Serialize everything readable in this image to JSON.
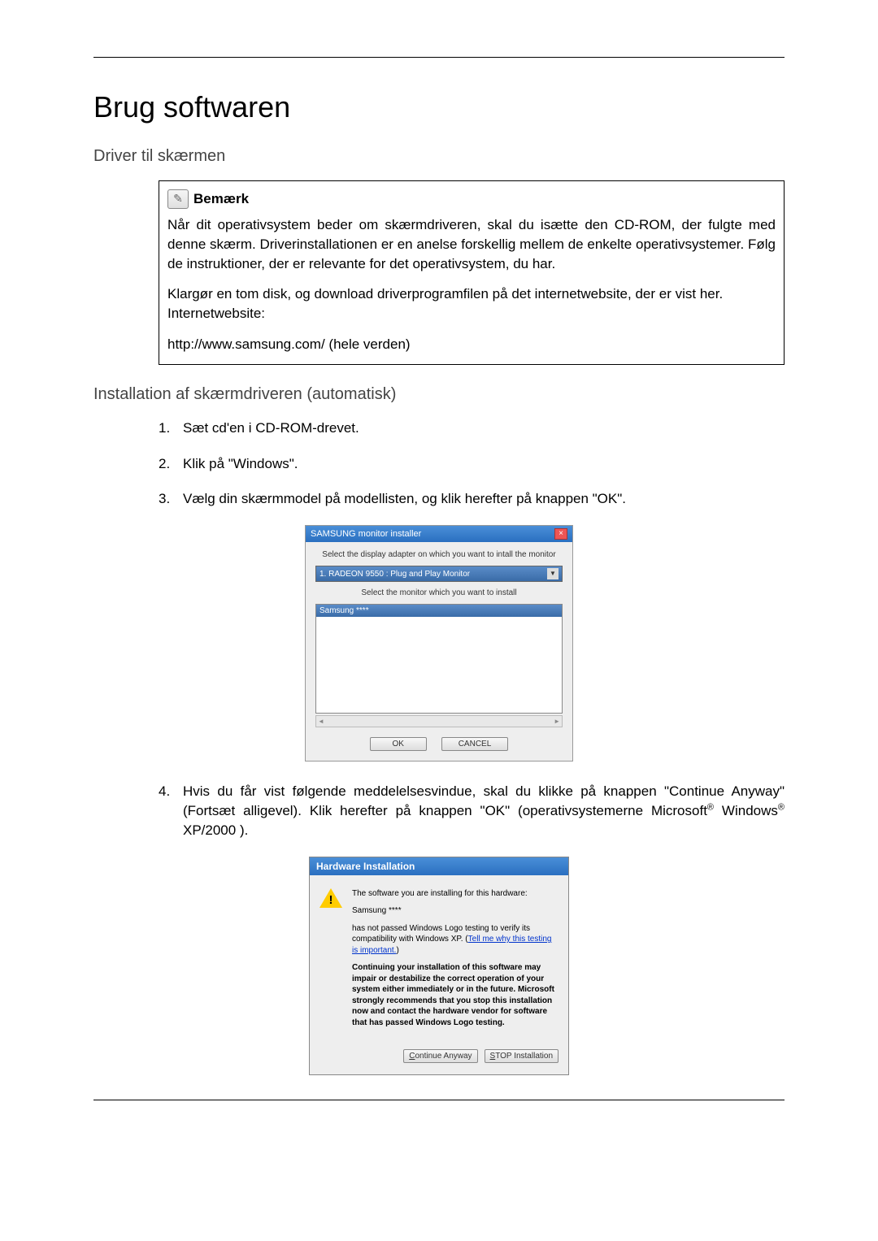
{
  "title": "Brug softwaren",
  "section1": "Driver til skærmen",
  "note": {
    "label": "Bemærk",
    "p1": "Når dit operativsystem beder om skærmdriveren, skal du isætte den CD-ROM, der fulgte med denne skærm. Driverinstallationen er en anelse forskellig mellem de enkelte operativsystemer. Følg de instruktioner, der er relevante for det operativsystem, du har.",
    "p2": "Klargør en tom disk, og download driverprogramfilen på det internetwebsite, der er vist her.",
    "website_label": "Internetwebsite:",
    "url": "http://www.samsung.com/ (hele verden)"
  },
  "section2": "Installation af skærmdriveren (automatisk)",
  "steps": {
    "n1": "1.",
    "n2": "2.",
    "n3": "3.",
    "n4": "4.",
    "s1": "Sæt cd'en i CD-ROM-drevet.",
    "s2": "Klik på \"Windows\".",
    "s3": "Vælg din skærmmodel på modellisten, og klik herefter på knappen \"OK\".",
    "s4a": "Hvis du får vist følgende meddelelsesvindue, skal du klikke på knappen \"Continue Anyway\" (Fortsæt alligevel). Klik herefter på knappen \"OK\" (operativsystemerne Microsoft",
    "s4b": " Windows",
    "s4c": " XP/2000 )."
  },
  "dialog1": {
    "title": "SAMSUNG monitor installer",
    "text1": "Select the display adapter on which you want to intall the monitor",
    "dropdown": "1. RADEON 9550 : Plug and Play Monitor",
    "text2": "Select the monitor which you want to install",
    "selected": "Samsung ****",
    "ok": "OK",
    "cancel": "CANCEL"
  },
  "dialog2": {
    "title": "Hardware Installation",
    "p1": "The software you are installing for this hardware:",
    "p2": "Samsung ****",
    "p3a": "has not passed Windows Logo testing to verify its compatibility with Windows XP. (",
    "p3link": "Tell me why this testing is important.",
    "p3b": ")",
    "p4": "Continuing your installation of this software may impair or destabilize the correct operation of your system either immediately or in the future. Microsoft strongly recommends that you stop this installation now and contact the hardware vendor for software that has passed Windows Logo testing.",
    "btn1a": "C",
    "btn1b": "ontinue Anyway",
    "btn2a": "S",
    "btn2b": "TOP Installation"
  }
}
